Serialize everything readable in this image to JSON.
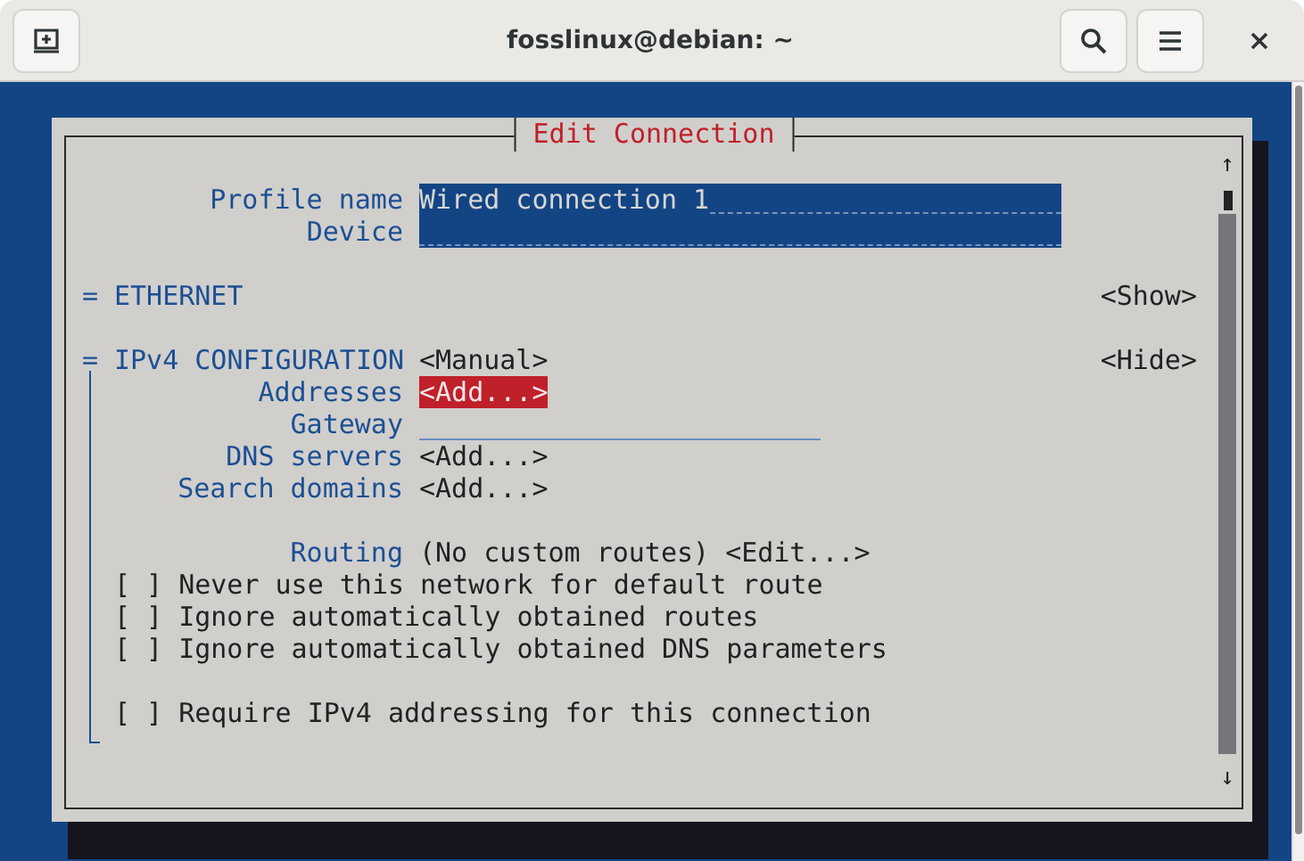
{
  "window": {
    "title": "fosslinux@debian: ~"
  },
  "dialog": {
    "title": "Edit Connection",
    "fields": [
      {
        "label": "Profile name",
        "value": "Wired connection 1"
      },
      {
        "label": "Device"
      }
    ],
    "sections": [
      {
        "marker": "=",
        "title": "ETHERNET",
        "toggle": "<Show>",
        "expanded": false
      },
      {
        "marker": "=",
        "title": "IPv4 CONFIGURATION",
        "mode": "<Manual>",
        "toggle": "<Hide>",
        "expanded": true,
        "rows": [
          {
            "kind": "button",
            "label": "Addresses",
            "button": "<Add...>",
            "selected": true,
            "separated": false
          },
          {
            "kind": "input",
            "label": "Gateway",
            "separated": false
          },
          {
            "kind": "button",
            "label": "DNS servers",
            "button": "<Add...>",
            "selected": false,
            "separated": false
          },
          {
            "kind": "button",
            "label": "Search domains",
            "button": "<Add...>",
            "selected": false,
            "separated": false
          },
          {
            "kind": "routing",
            "label": "Routing",
            "value": "(No custom routes)",
            "button": "<Edit...>",
            "selected": false,
            "separated": true
          },
          {
            "kind": "checkbox",
            "box": "[ ]",
            "label": "Never use this network for default route",
            "checked": false,
            "separated": false
          },
          {
            "kind": "checkbox",
            "box": "[ ]",
            "label": "Ignore automatically obtained routes",
            "checked": false,
            "separated": false
          },
          {
            "kind": "checkbox",
            "box": "[ ]",
            "label": "Ignore automatically obtained DNS parameters",
            "checked": false,
            "separated": false
          },
          {
            "kind": "checkbox",
            "box": "[ ]",
            "label": "Require IPv4 addressing for this connection",
            "checked": false,
            "separated": true
          }
        ]
      }
    ],
    "scrollbar": {
      "up": "↑",
      "down": "↓"
    }
  }
}
